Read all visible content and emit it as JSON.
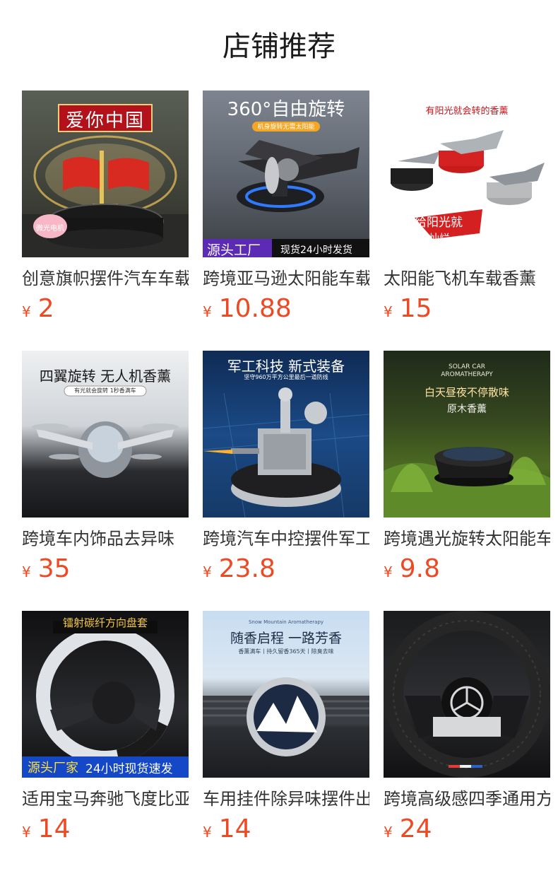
{
  "header": {
    "title": "店铺推荐"
  },
  "products": [
    {
      "name": "创意旗帜摆件汽车车载",
      "currency": "¥",
      "price": "2",
      "image": {
        "headline": "爱你中国",
        "badge": "微光电机"
      }
    },
    {
      "name": "跨境亚马逊太阳能车载",
      "currency": "¥",
      "price": "10.88",
      "image": {
        "headline": "360°自由旋转",
        "sub": "机身旋转无需太阳能",
        "footer_left": "源头工厂",
        "footer_right": "现货24小时发货"
      }
    },
    {
      "name": "太阳能飞机车载香薰",
      "currency": "¥",
      "price": "15",
      "image": {
        "headline": "有阳光就会转的香薰",
        "badge_line1": "给阳光就",
        "badge_line2": "灿烂"
      }
    },
    {
      "name": "跨境车内饰品去异味",
      "currency": "¥",
      "price": "35",
      "image": {
        "headline": "四翼旋转 无人机香薰",
        "sub": "有光就会旋转 1秒香满车"
      }
    },
    {
      "name": "跨境汽车中控摆件军工",
      "currency": "¥",
      "price": "23.8",
      "image": {
        "headline": "军工科技 新式装备",
        "sub": "坚守960万平方公里最后一道防线"
      }
    },
    {
      "name": "跨境遇光旋转太阳能车",
      "currency": "¥",
      "price": "9.8",
      "image": {
        "brand_line1": "SOLAR CAR",
        "brand_line2": "AROMATHERAPY",
        "headline": "白天昼夜不停散味",
        "sub": "原木香薰"
      }
    },
    {
      "name": "适用宝马奔驰飞度比亚",
      "currency": "¥",
      "price": "14",
      "image": {
        "headline": "镭射碳纤方向盘套",
        "footer_left": "源头厂家",
        "footer_right": "24小时现货速发"
      }
    },
    {
      "name": "车用挂件除异味摆件出",
      "currency": "¥",
      "price": "14",
      "image": {
        "brand": "Snow Mountain Aromatherapy",
        "headline": "随香启程 一路芳香",
        "sub": "香薰满车丨持久留香365天丨除臭去味"
      }
    },
    {
      "name": "跨境高级感四季通用方",
      "currency": "¥",
      "price": "24",
      "image": {}
    }
  ]
}
